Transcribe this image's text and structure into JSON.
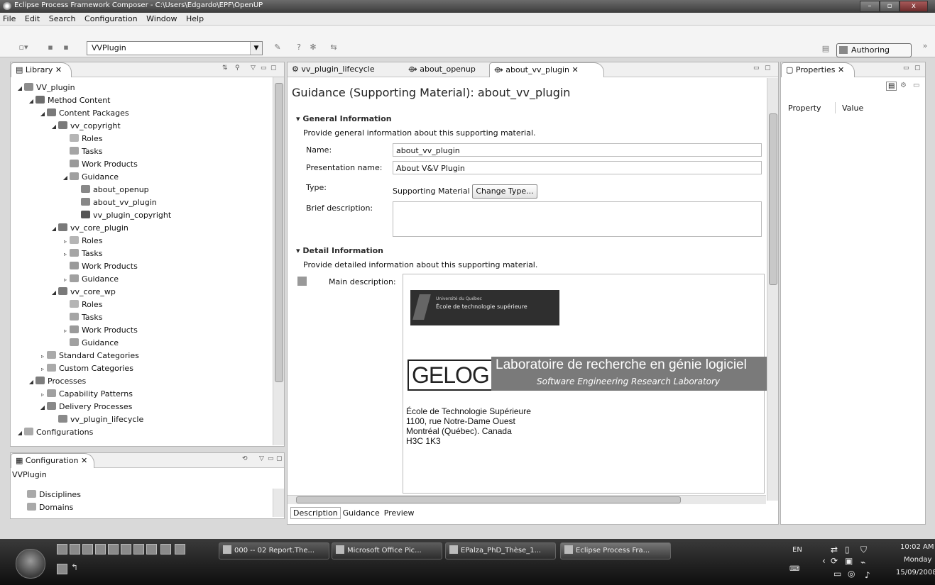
{
  "window": {
    "title": "Eclipse Process Framework Composer - C:\\Users\\Edgardo\\EPF\\OpenUP",
    "controls": [
      "–",
      "▫",
      "x"
    ]
  },
  "menu": [
    "File",
    "Edit",
    "Search",
    "Configuration",
    "Window",
    "Help"
  ],
  "toolbar": {
    "plugin_select": "VVPlugin",
    "perspective": "Authoring"
  },
  "library": {
    "tab": "Library",
    "tree": [
      {
        "label": "VV_plugin",
        "indent": 0,
        "tw": "◢",
        "icon": "plugin-icon"
      },
      {
        "label": "Method Content",
        "indent": 1,
        "tw": "◢",
        "icon": "method-content-icon"
      },
      {
        "label": "Content Packages",
        "indent": 2,
        "tw": "◢",
        "icon": "package-icon"
      },
      {
        "label": "vv_copyright",
        "indent": 3,
        "tw": "◢",
        "icon": "package-icon"
      },
      {
        "label": "Roles",
        "indent": 4,
        "tw": "",
        "icon": "roles-icon"
      },
      {
        "label": "Tasks",
        "indent": 4,
        "tw": "",
        "icon": "tasks-icon"
      },
      {
        "label": "Work Products",
        "indent": 4,
        "tw": "",
        "icon": "work-products-icon"
      },
      {
        "label": "Guidance",
        "indent": 4,
        "tw": "◢",
        "icon": "guidance-icon"
      },
      {
        "label": "about_openup",
        "indent": 5,
        "tw": "",
        "icon": "supporting-material-icon"
      },
      {
        "label": "about_vv_plugin",
        "indent": 5,
        "tw": "",
        "icon": "supporting-material-icon"
      },
      {
        "label": "vv_plugin_copyright",
        "indent": 5,
        "tw": "",
        "icon": "copyright-icon"
      },
      {
        "label": "vv_core_plugin",
        "indent": 3,
        "tw": "◢",
        "icon": "package-icon"
      },
      {
        "label": "Roles",
        "indent": 4,
        "tw": "▹",
        "icon": "roles-icon"
      },
      {
        "label": "Tasks",
        "indent": 4,
        "tw": "▹",
        "icon": "tasks-icon"
      },
      {
        "label": "Work Products",
        "indent": 4,
        "tw": "",
        "icon": "work-products-icon"
      },
      {
        "label": "Guidance",
        "indent": 4,
        "tw": "▹",
        "icon": "guidance-icon"
      },
      {
        "label": "vv_core_wp",
        "indent": 3,
        "tw": "◢",
        "icon": "package-icon"
      },
      {
        "label": "Roles",
        "indent": 4,
        "tw": "",
        "icon": "roles-icon"
      },
      {
        "label": "Tasks",
        "indent": 4,
        "tw": "",
        "icon": "tasks-icon"
      },
      {
        "label": "Work Products",
        "indent": 4,
        "tw": "▹",
        "icon": "work-products-icon"
      },
      {
        "label": "Guidance",
        "indent": 4,
        "tw": "",
        "icon": "guidance-icon"
      },
      {
        "label": "Standard Categories",
        "indent": 2,
        "tw": "▹",
        "icon": "category-icon"
      },
      {
        "label": "Custom Categories",
        "indent": 2,
        "tw": "▹",
        "icon": "category-icon"
      },
      {
        "label": "Processes",
        "indent": 1,
        "tw": "◢",
        "icon": "processes-icon"
      },
      {
        "label": "Capability Patterns",
        "indent": 2,
        "tw": "▹",
        "icon": "capability-pattern-icon"
      },
      {
        "label": "Delivery Processes",
        "indent": 2,
        "tw": "◢",
        "icon": "delivery-process-icon"
      },
      {
        "label": "vv_plugin_lifecycle",
        "indent": 3,
        "tw": "",
        "icon": "lifecycle-icon"
      },
      {
        "label": "Configurations",
        "indent": 0,
        "tw": "◢",
        "icon": "configurations-icon"
      }
    ]
  },
  "configuration": {
    "tab": "Configuration",
    "name": "VVPlugin",
    "items": [
      "Disciplines",
      "Domains"
    ]
  },
  "editor": {
    "tabs": [
      "vv_plugin_lifecycle",
      "about_openup",
      "about_vv_plugin"
    ],
    "title": "Guidance (Supporting Material): about_vv_plugin",
    "general": {
      "header": "General Information",
      "desc": "Provide general information about this supporting material.",
      "name_label": "Name:",
      "name_value": "about_vv_plugin",
      "presentation_label": "Presentation name:",
      "presentation_value": "About V&V Plugin",
      "type_label": "Type:",
      "type_value": "Supporting Material",
      "change_type": "Change Type...",
      "brief_label": "Brief description:"
    },
    "detail": {
      "header": "Detail Information",
      "desc": "Provide detailed information about this supporting material.",
      "main_label": "Main description:",
      "ets_small": "Université du Québec",
      "ets_logo": "École de technologie supérieure",
      "gelog_mark": "GELOG",
      "gelog_title": "Laboratoire de recherche en génie logiciel",
      "gelog_subtitle": "Software Engineering Research Laboratory",
      "address": [
        "École de Technologie Supérieure",
        "1100, rue Notre-Dame Ouest",
        "Montréal (Québec). Canada",
        "H3C 1K3"
      ]
    },
    "bottom_tabs": [
      "Description",
      "Guidance",
      "Preview"
    ]
  },
  "properties": {
    "tab": "Properties",
    "columns": [
      "Property",
      "Value"
    ]
  },
  "taskbar": {
    "buttons": [
      "000 -- 02 Report.The...",
      "Microsoft Office Pic...",
      "EPalza_PhD_Thèse_1...",
      "Eclipse Process Fra..."
    ],
    "lang": "EN",
    "time": "10:02 AM",
    "day": "Monday",
    "date": "15/09/2008"
  },
  "colors": {
    "titlebar": "#4a4a4a",
    "taskbar": "#1c1c1c",
    "logo_dark": "#2f2f2f",
    "gelog_band": "#7a7a7a"
  }
}
